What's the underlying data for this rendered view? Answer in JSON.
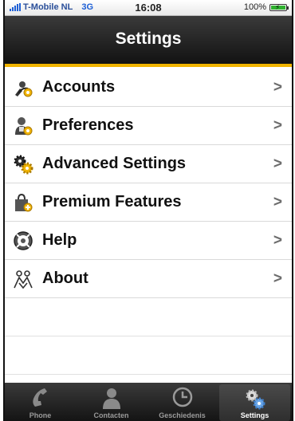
{
  "status_bar": {
    "carrier": "T-Mobile NL",
    "network": "3G",
    "time": "16:08",
    "battery": "100%",
    "battery_level": 1.0
  },
  "nav": {
    "title": "Settings"
  },
  "settings_items": [
    {
      "label": "Accounts",
      "icon": "accounts-icon"
    },
    {
      "label": "Preferences",
      "icon": "preferences-icon"
    },
    {
      "label": "Advanced Settings",
      "icon": "advanced-settings-icon"
    },
    {
      "label": "Premium Features",
      "icon": "premium-features-icon"
    },
    {
      "label": "Help",
      "icon": "help-icon"
    },
    {
      "label": "About",
      "icon": "about-icon"
    }
  ],
  "chevron": ">",
  "tabs": [
    {
      "label": "Phone",
      "icon": "phone-icon",
      "active": false
    },
    {
      "label": "Contacten",
      "icon": "contacts-icon",
      "active": false
    },
    {
      "label": "Geschiedenis",
      "icon": "clock-icon",
      "active": false
    },
    {
      "label": "Settings",
      "icon": "gears-icon",
      "active": true
    }
  ],
  "colors": {
    "accent": "#f1b400",
    "nav_bg": "#1e1e1e",
    "network_blue": "#1d5fd6"
  }
}
